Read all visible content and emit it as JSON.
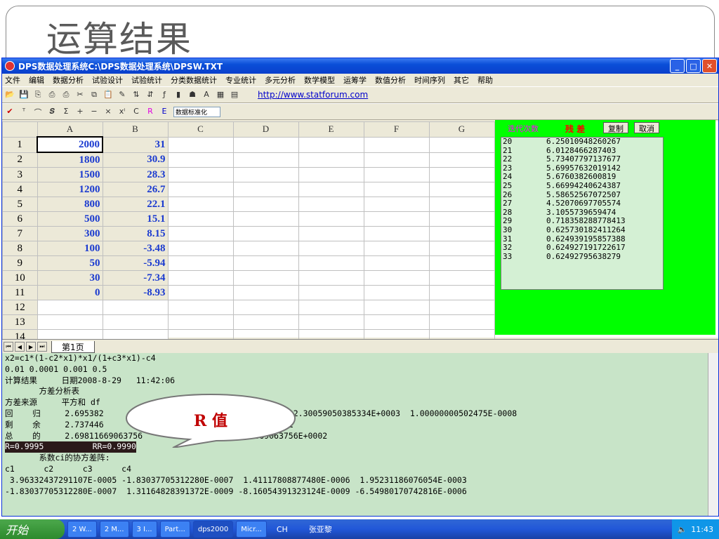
{
  "slide": {
    "title": "运算结果"
  },
  "window": {
    "title": "DPS数据处理系统C:\\DPS数据处理系统\\DPSW.TXT",
    "min": "_",
    "max": "□",
    "close": "✕"
  },
  "menu": [
    "文件",
    "编辑",
    "数据分析",
    "试验设计",
    "试验统计",
    "分类数据统计",
    "专业统计",
    "多元分析",
    "数学模型",
    "运筹学",
    "数值分析",
    "时间序列",
    "其它",
    "帮助"
  ],
  "toolbar": {
    "link": "http://www.statforum.com",
    "select_value": "数据标准化"
  },
  "sheet": {
    "columns": [
      "A",
      "B",
      "C",
      "D",
      "E",
      "F",
      "G"
    ],
    "rows": [
      {
        "n": "1",
        "a": "2000",
        "b": "31"
      },
      {
        "n": "2",
        "a": "1800",
        "b": "30.9"
      },
      {
        "n": "3",
        "a": "1500",
        "b": "28.3"
      },
      {
        "n": "4",
        "a": "1200",
        "b": "26.7"
      },
      {
        "n": "5",
        "a": "800",
        "b": "22.1"
      },
      {
        "n": "6",
        "a": "500",
        "b": "15.1"
      },
      {
        "n": "7",
        "a": "300",
        "b": "8.15"
      },
      {
        "n": "8",
        "a": "100",
        "b": "-3.48"
      },
      {
        "n": "9",
        "a": "50",
        "b": "-5.94"
      },
      {
        "n": "10",
        "a": "30",
        "b": "-7.34"
      },
      {
        "n": "11",
        "a": "0",
        "b": "-8.93"
      },
      {
        "n": "12",
        "a": "",
        "b": ""
      },
      {
        "n": "13",
        "a": "",
        "b": ""
      },
      {
        "n": "14",
        "a": "",
        "b": ""
      }
    ],
    "tab": "第1页"
  },
  "iteration": {
    "header": "迭代次数",
    "residual": "残  差",
    "copy": "复制",
    "cancel": "取消",
    "rows": [
      [
        "20",
        "6.25010948260267"
      ],
      [
        "21",
        "6.0128466287403"
      ],
      [
        "22",
        "5.73407797137677"
      ],
      [
        "23",
        "5.69957632019142"
      ],
      [
        "24",
        "5.6760382600819"
      ],
      [
        "25",
        "5.66994240624387"
      ],
      [
        "26",
        "5.58652567072507"
      ],
      [
        "27",
        "4.52070697705574"
      ],
      [
        "28",
        "3.1055739659474"
      ],
      [
        "29",
        "0.718358288778413"
      ],
      [
        "30",
        "0.625730182411264"
      ],
      [
        "31",
        "0.624939195857388"
      ],
      [
        "32",
        "0.624927191722617"
      ],
      [
        "33",
        "0.62492795638279"
      ]
    ]
  },
  "output": {
    "lines": [
      "x2=c1*(1-c2*x1)*x1/(1+c3*x1)-c4",
      "0.01 0.0001 0.001 0.5",
      "计算结果     日期2008-8-29   11:42:06",
      "       方差分析表",
      "方差来源     平方和 df",
      "回    归     2.695382                        2011452E+0002  2.30059050385334E+0003  1.00000000502475E-0008",
      "剩    余     2.737446                        043314156E 0001",
      "总    的     2.69811669063756                2.69811669063756E+0002"
    ],
    "r_line": "R=0.9995          RR=0.9990",
    "lines2": [
      "       系数ci的协方差阵:",
      "c1      c2      c3      c4",
      " 3.96332437291107E-0005 -1.83037705312280E-0007  1.41117808877480E-0006  1.95231186076054E-0003",
      "-1.83037705312280E-0007  1.31164828391372E-0009 -8.16054391323124E-0009 -6.54980170742816E-0006"
    ]
  },
  "callout": {
    "text": "R 值"
  },
  "taskbar": {
    "start": "开始",
    "items": [
      "2 W...",
      "2 M...",
      "3 I...",
      "Part...",
      "dps2000",
      "Micr..."
    ],
    "lang": "CH",
    "user": "张亚黎",
    "clock": "11:43"
  }
}
